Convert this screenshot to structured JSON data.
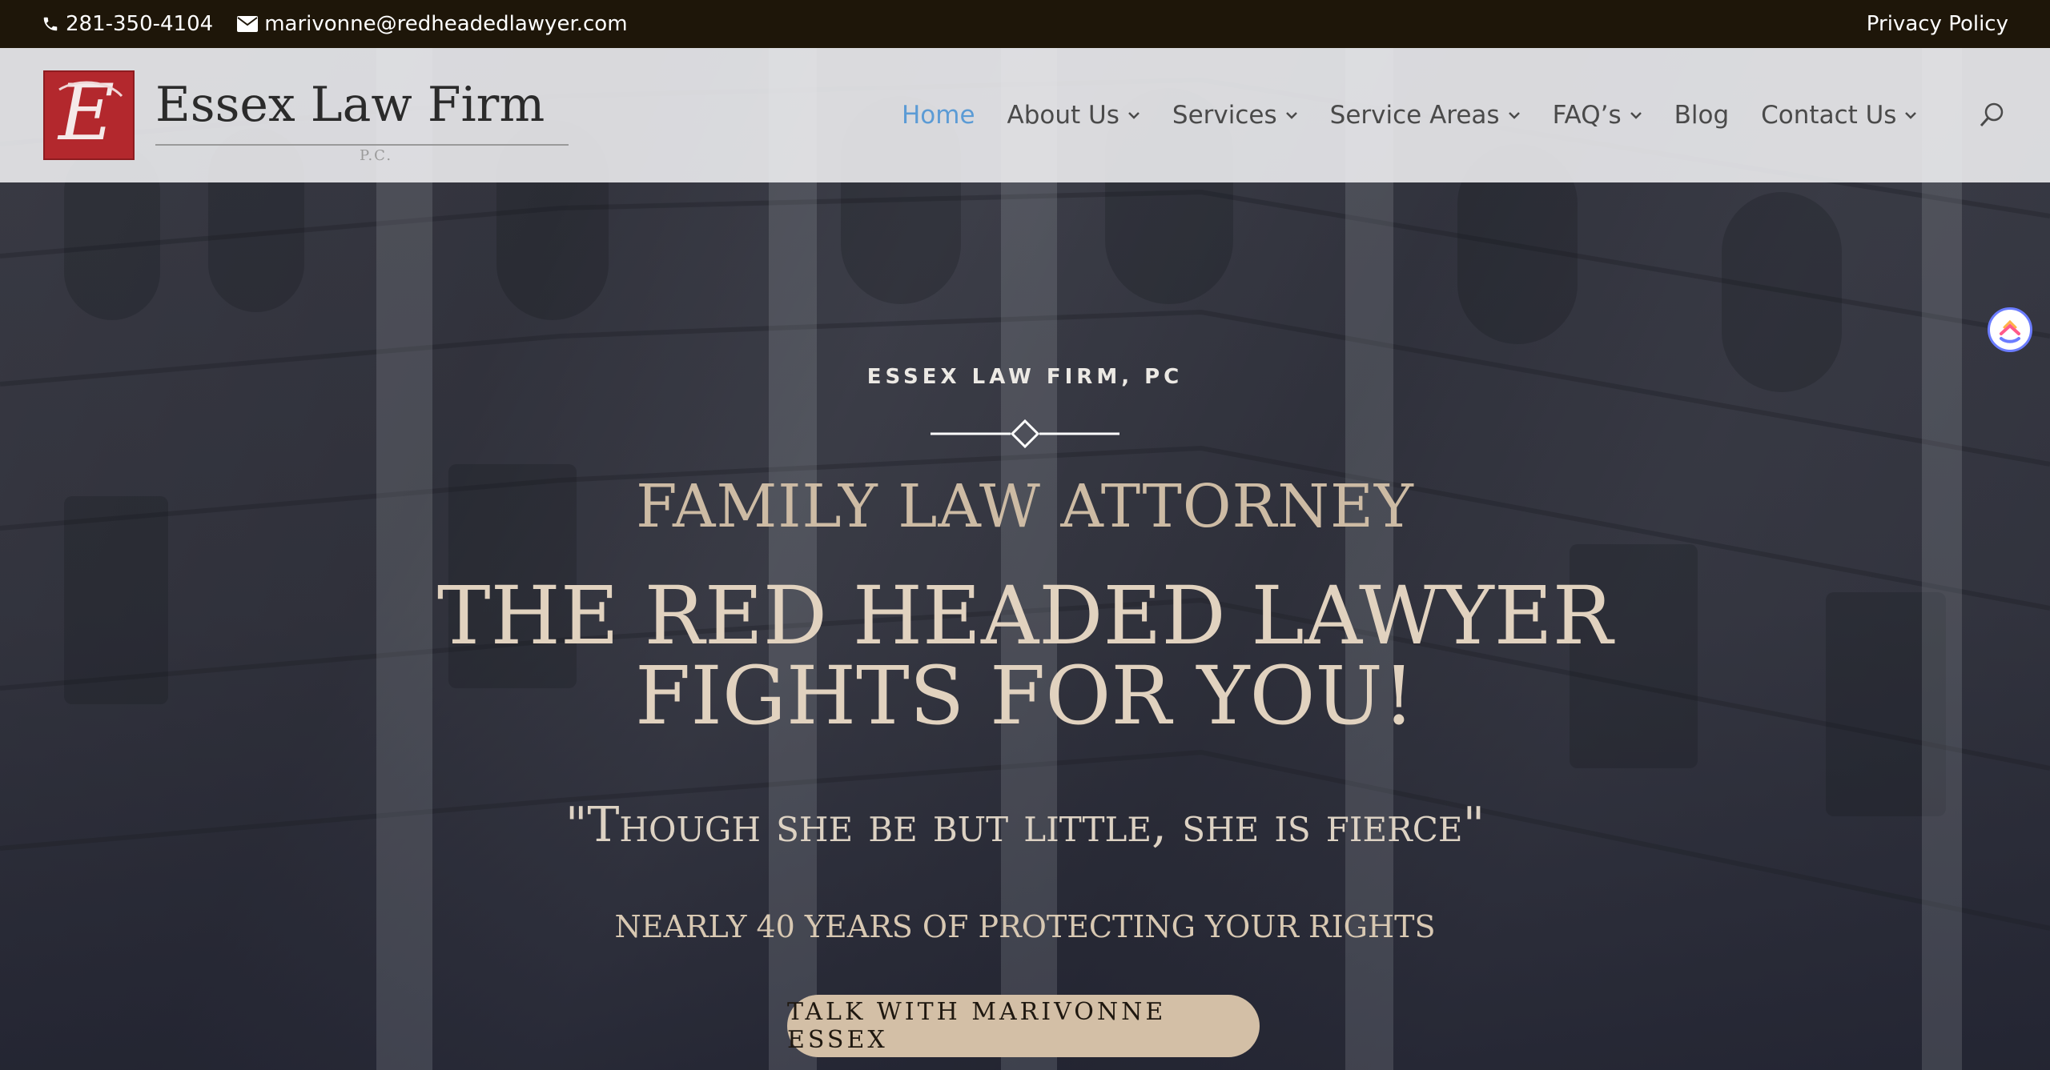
{
  "topbar": {
    "phone": "281-350-4104",
    "email": "marivonne@redheadedlawyer.com",
    "privacy_label": "Privacy Policy"
  },
  "logo": {
    "name": "Essex Law Firm",
    "suffix": "P.C.",
    "monogram": "E",
    "color": "#b3282d"
  },
  "nav": {
    "items": [
      {
        "label": "Home",
        "active": true,
        "dropdown": false
      },
      {
        "label": "About Us",
        "active": false,
        "dropdown": true
      },
      {
        "label": "Services",
        "active": false,
        "dropdown": true
      },
      {
        "label": "Service Areas",
        "active": false,
        "dropdown": true
      },
      {
        "label": "FAQ’s",
        "active": false,
        "dropdown": true
      },
      {
        "label": "Blog",
        "active": false,
        "dropdown": false
      },
      {
        "label": "Contact Us",
        "active": false,
        "dropdown": true
      }
    ],
    "search_icon": "search-icon",
    "active_color": "#5b9bd5"
  },
  "hero": {
    "kicker": "ESSEX LAW FIRM, PC",
    "subtitle": "FAMILY LAW ATTORNEY",
    "headline_line1": "THE RED HEADED LAWYER",
    "headline_line2": "FIGHTS FOR YOU!",
    "quote": "\"Though she be but little, she is fierce\"",
    "years": "NEARLY 40 YEARS OF PROTECTING YOUR RIGHTS",
    "cta_label": "TALK WITH MARIVONNE ESSEX",
    "accent_color": "#d3bfa6"
  },
  "widget": {
    "icon": "clickup-icon"
  }
}
